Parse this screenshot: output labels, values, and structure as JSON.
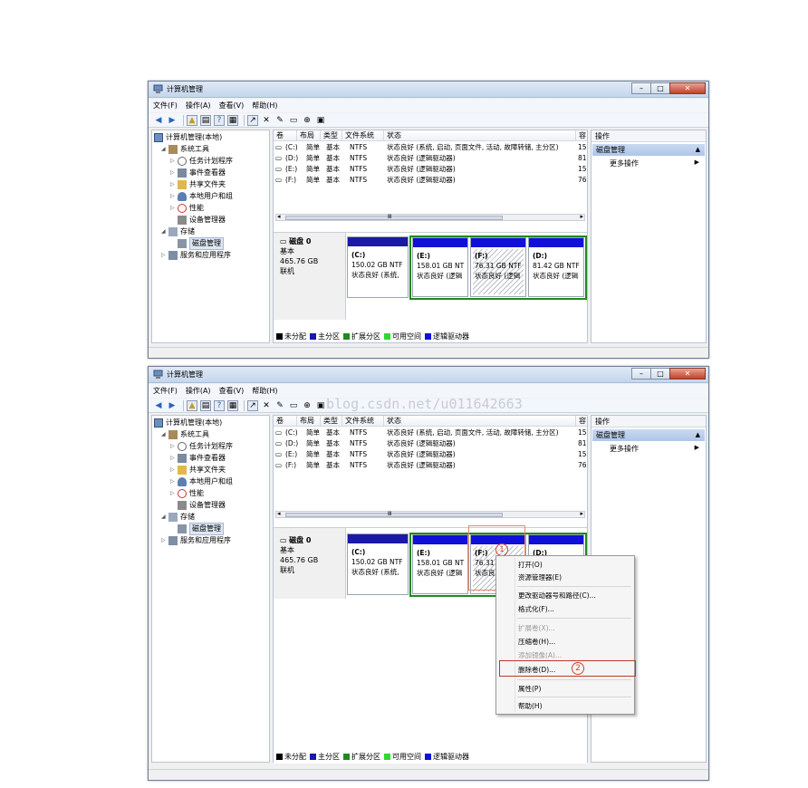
{
  "window": {
    "title": "计算机管理",
    "menu": [
      "文件(F)",
      "操作(A)",
      "查看(V)",
      "帮助(H)"
    ]
  },
  "tree": {
    "root": "计算机管理(本地)",
    "system_tools": "系统工具",
    "task_scheduler": "任务计划程序",
    "event_viewer": "事件查看器",
    "shared_folders": "共享文件夹",
    "local_users": "本地用户和组",
    "performance": "性能",
    "device_manager": "设备管理器",
    "storage": "存储",
    "disk_management": "磁盘管理",
    "services": "服务和应用程序"
  },
  "volumes": {
    "headers": [
      "卷",
      "布局",
      "类型",
      "文件系统",
      "状态",
      "容"
    ],
    "rows": [
      {
        "vol": "(C:)",
        "layout": "简单",
        "type": "基本",
        "fs": "NTFS",
        "status": "状态良好 (系统, 启动, 页面文件, 活动, 故障转储, 主分区)",
        "cap": "15"
      },
      {
        "vol": "(D:)",
        "layout": "简单",
        "type": "基本",
        "fs": "NTFS",
        "status": "状态良好 (逻辑驱动器)",
        "cap": "81"
      },
      {
        "vol": "(E:)",
        "layout": "简单",
        "type": "基本",
        "fs": "NTFS",
        "status": "状态良好 (逻辑驱动器)",
        "cap": "15"
      },
      {
        "vol": "(F:)",
        "layout": "简单",
        "type": "基本",
        "fs": "NTFS",
        "status": "状态良好 (逻辑驱动器)",
        "cap": "76"
      }
    ],
    "scroll_mark": "Ⅲ"
  },
  "disk": {
    "name": "磁盘 0",
    "type": "基本",
    "size": "465.76 GB",
    "state": "联机",
    "parts": [
      {
        "letter": "(C:)",
        "size": "150.02 GB NTF",
        "status": "状态良好 (系统,"
      },
      {
        "letter": "(E:)",
        "size": "158.01 GB NT",
        "status": "状态良好 (逻辑"
      },
      {
        "letter": "(F:)",
        "size": "76.31 GB NTF",
        "status": "状态良好 (逻辑"
      },
      {
        "letter": "(D:)",
        "size": "81.42 GB NTF",
        "status": "状态良好 (逻辑"
      }
    ],
    "parts2": [
      {
        "letter": "(C:)",
        "size": "150.02 GB NTF",
        "status": "状态良好 (系统,"
      },
      {
        "letter": "(E:)",
        "size": "158.01 GB NT",
        "status": "状态良好 (逻辑"
      },
      {
        "letter": "(F:)",
        "size": "76.31",
        "status": "状态良"
      },
      {
        "letter": "(D:)",
        "size": "",
        "status": ""
      }
    ]
  },
  "legend": [
    "未分配",
    "主分区",
    "扩展分区",
    "可用空间",
    "逻辑驱动器"
  ],
  "colors": {
    "unallocated": "#000000",
    "primary": "#1a1aa6",
    "extended": "#1f8a1f",
    "free": "#33d633",
    "logical": "#1010d8",
    "highlight": "#c0392b"
  },
  "actions": {
    "header": "操作",
    "section": "磁盘管理",
    "more": "更多操作"
  },
  "context_menu": {
    "open": "打开(O)",
    "explore": "资源管理器(E)",
    "change_letter": "更改驱动器号和路径(C)...",
    "format": "格式化(F)...",
    "extend": "扩展卷(X)...",
    "shrink": "压缩卷(H)...",
    "mirror": "添加镜像(A)...",
    "delete": "删除卷(D)...",
    "properties": "属性(P)",
    "help": "帮助(H)"
  },
  "annotations": {
    "step1": "1",
    "step2": "2"
  },
  "watermark": "blog.csdn.net/u011642663"
}
